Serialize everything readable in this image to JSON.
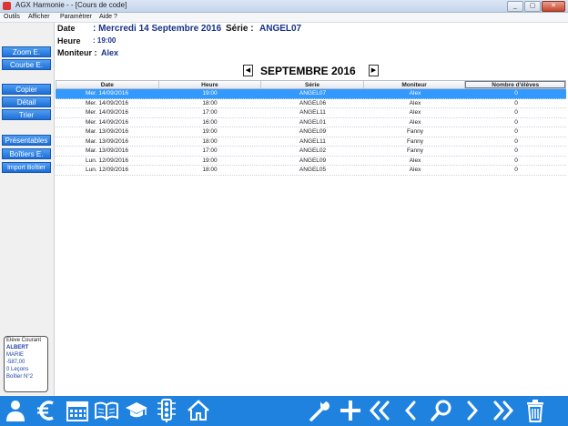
{
  "window": {
    "title": "AGX Harmonie - - [Cours de code]",
    "buttons": {
      "minimize": "_",
      "maximize": "▢",
      "close": "✕"
    }
  },
  "menu": [
    "Outils",
    "Afficher",
    "Paramètrer",
    "Aide ?"
  ],
  "sidebar": {
    "group1": [
      "Zoom E.",
      "Courbe E."
    ],
    "group2": [
      "Copier",
      "Détail",
      "Trier"
    ],
    "group3": [
      "Présentables",
      "Boîtiers E.",
      "Import Boîtier"
    ]
  },
  "eleve": {
    "header": "Elève Courant",
    "name": "ALBERT",
    "firstname": "MARIE",
    "balance": "-587,00",
    "lessons": "0 Leçons",
    "boitier": "Boîtier N°2"
  },
  "info": {
    "date_label": "Date",
    "date_value": ": Mercredi 14 Septembre 2016",
    "serie_label": "Série :",
    "serie_value": "ANGEL07",
    "heure_label": "Heure",
    "heure_value": ": 19:00",
    "moniteur_label": "Moniteur :",
    "moniteur_value": "Alex"
  },
  "month": {
    "title": "SEPTEMBRE 2016",
    "prev": "◀",
    "next": "▶"
  },
  "table": {
    "columns": [
      "Date",
      "Heure",
      "Série",
      "Moniteur",
      "Nombre d'élèves"
    ],
    "rows": [
      {
        "date": "Mer. 14/09/2016",
        "heure": "19:00",
        "serie": "ANGEL07",
        "moniteur": "Alex",
        "nb": "0",
        "selected": true
      },
      {
        "date": "Mer. 14/09/2016",
        "heure": "18:00",
        "serie": "ANGEL06",
        "moniteur": "Alex",
        "nb": "0"
      },
      {
        "date": "Mer. 14/09/2016",
        "heure": "17:00",
        "serie": "ANGEL11",
        "moniteur": "Alex",
        "nb": "0"
      },
      {
        "date": "Mer. 14/09/2016",
        "heure": "16:00",
        "serie": "ANGEL01",
        "moniteur": "Alex",
        "nb": "0"
      },
      {
        "date": "Mar. 13/09/2016",
        "heure": "19:00",
        "serie": "ANGEL09",
        "moniteur": "Fanny",
        "nb": "0"
      },
      {
        "date": "Mar. 13/09/2016",
        "heure": "18:00",
        "serie": "ANGEL11",
        "moniteur": "Fanny",
        "nb": "0"
      },
      {
        "date": "Mar. 13/09/2016",
        "heure": "17:00",
        "serie": "ANGEL02",
        "moniteur": "Fanny",
        "nb": "0"
      },
      {
        "date": "Lun. 12/09/2016",
        "heure": "19:00",
        "serie": "ANGEL09",
        "moniteur": "Alex",
        "nb": "0"
      },
      {
        "date": "Lun. 12/09/2016",
        "heure": "18:00",
        "serie": "ANGEL05",
        "moniteur": "Alex",
        "nb": "0"
      }
    ]
  },
  "toolbar": {
    "left": [
      "user-icon",
      "euro-icon",
      "calendar-icon",
      "book-icon",
      "graduation-cap-icon",
      "traffic-light-icon",
      "home-icon"
    ],
    "right": [
      "wrench-icon",
      "plus-icon",
      "first-icon",
      "previous-icon",
      "search-icon",
      "next-icon",
      "last-icon",
      "trash-icon"
    ]
  },
  "colors": {
    "accent": "#1f82df",
    "selection": "#3399ff",
    "text_value": "#17328a"
  }
}
